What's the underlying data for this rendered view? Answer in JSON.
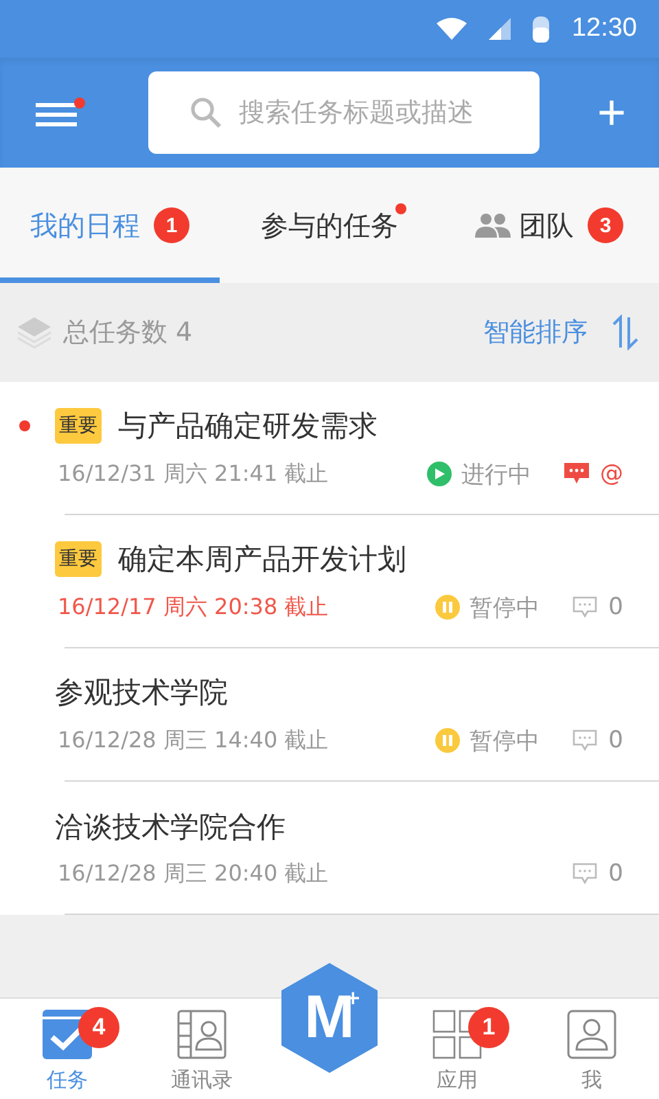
{
  "status_bar": {
    "time": "12:30"
  },
  "app_bar": {
    "menu_dot": true,
    "search": {
      "placeholder": "搜索任务标题或描述"
    },
    "add": "+"
  },
  "tabs": [
    {
      "label": "我的日程",
      "selected": true,
      "kind": "plain",
      "badge": "1",
      "dot": false
    },
    {
      "label": "参与的任务",
      "selected": false,
      "kind": "plain",
      "dot": true
    },
    {
      "label": "团队",
      "selected": false,
      "kind": "team",
      "badge": "3",
      "dot": false
    }
  ],
  "summary": {
    "total": "总任务数 4",
    "sort": "智能排序"
  },
  "tasks": [
    {
      "title": "与产品确定研发需求",
      "important": true,
      "tag": "重要",
      "unread": true,
      "deadline": "16/12/31 周六 21:41 截止",
      "overdue": false,
      "status": {
        "kind": "running",
        "text": "进行中"
      },
      "comments": {
        "kind": "mention",
        "text": "@"
      }
    },
    {
      "title": "确定本周产品开发计划",
      "important": true,
      "tag": "重要",
      "unread": false,
      "deadline": "16/12/17 周六 20:38 截止",
      "overdue": true,
      "status": {
        "kind": "paused",
        "text": "暂停中"
      },
      "comments": {
        "kind": "count",
        "text": "0"
      }
    },
    {
      "title": "参观技术学院",
      "important": false,
      "unread": false,
      "deadline": "16/12/28 周三 14:40 截止",
      "overdue": false,
      "status": {
        "kind": "paused",
        "text": "暂停中"
      },
      "comments": {
        "kind": "count",
        "text": "0"
      }
    },
    {
      "title": "洽谈技术学院合作",
      "important": false,
      "unread": false,
      "deadline": "16/12/28 周三 20:40 截止",
      "overdue": false,
      "comments": {
        "kind": "count",
        "text": "0"
      }
    }
  ],
  "bottom_nav": {
    "items": [
      {
        "kind": "tasks",
        "label": "任务",
        "selected": true,
        "badge": "4"
      },
      {
        "kind": "contacts",
        "label": "通讯录",
        "selected": false
      },
      {
        "kind": "logo",
        "letter": "M",
        "mark": "+"
      },
      {
        "kind": "apps",
        "label": "应用",
        "selected": false,
        "badge": "1"
      },
      {
        "kind": "me",
        "label": "我",
        "selected": false
      }
    ]
  }
}
